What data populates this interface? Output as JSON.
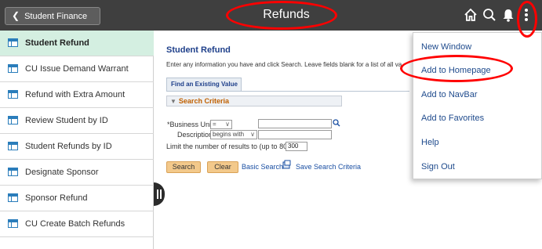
{
  "header": {
    "back_label": "Student Finance",
    "title": "Refunds",
    "icons": [
      "home-icon",
      "search-icon",
      "bell-icon",
      "kebab-menu-icon"
    ]
  },
  "sidebar": {
    "items": [
      {
        "label": "Student Refund",
        "active": true
      },
      {
        "label": "CU Issue Demand Warrant"
      },
      {
        "label": "Refund with Extra Amount"
      },
      {
        "label": "Review Student by ID"
      },
      {
        "label": "Student Refunds by ID"
      },
      {
        "label": "Designate Sponsor"
      },
      {
        "label": "Sponsor Refund"
      },
      {
        "label": "CU Create Batch Refunds"
      }
    ]
  },
  "main": {
    "title": "Student Refund",
    "instructions": "Enter any information you have and click Search. Leave fields blank for a list of all valu",
    "tab_find": "Find an Existing Value",
    "criteria_title": "Search Criteria",
    "business_unit_label": "*Business Unit",
    "business_unit_operator": "=",
    "description_label": "Description",
    "description_operator": "begins with",
    "limit_label": "Limit the number of results to (up to 800):",
    "limit_value": "300",
    "search_button": "Search",
    "clear_button": "Clear",
    "basic_search_link": "Basic Search",
    "save_criteria_link": "Save Search Criteria"
  },
  "menu": {
    "items": [
      "New Window",
      "Add to Homepage",
      "Add to NavBar",
      "Add to Favorites",
      "Help",
      "Sign Out"
    ]
  },
  "annotation_color": "#ff0000",
  "colors": {
    "header_bg": "#3f3f3f",
    "active_item_bg": "#d4efe1",
    "link_blue": "#1e4a8c",
    "button_orange": "#f3c98b"
  }
}
